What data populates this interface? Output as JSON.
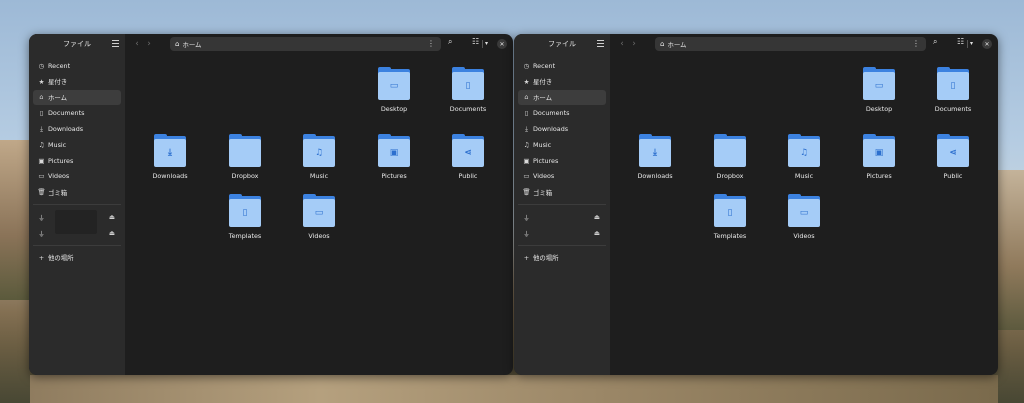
{
  "windows": [
    {
      "sidebar": {
        "title": "ファイル",
        "items": [
          {
            "label": "Recent",
            "icon": "clock-icon"
          },
          {
            "label": "星付き",
            "icon": "star-icon"
          },
          {
            "label": "ホーム",
            "icon": "home-icon",
            "active": true
          },
          {
            "label": "Documents",
            "icon": "document-icon"
          },
          {
            "label": "Downloads",
            "icon": "download-icon"
          },
          {
            "label": "Music",
            "icon": "music-icon"
          },
          {
            "label": "Pictures",
            "icon": "picture-icon"
          },
          {
            "label": "Videos",
            "icon": "video-icon"
          },
          {
            "label": "ゴミ箱",
            "icon": "trash-icon"
          }
        ],
        "other_locations": "他の場所"
      },
      "path": "ホーム"
    },
    {
      "sidebar": {
        "title": "ファイル",
        "items": [
          {
            "label": "Recent",
            "icon": "clock-icon"
          },
          {
            "label": "星付き",
            "icon": "star-icon"
          },
          {
            "label": "ホーム",
            "icon": "home-icon",
            "active": true
          },
          {
            "label": "Documents",
            "icon": "document-icon"
          },
          {
            "label": "Downloads",
            "icon": "download-icon"
          },
          {
            "label": "Music",
            "icon": "music-icon"
          },
          {
            "label": "Pictures",
            "icon": "picture-icon"
          },
          {
            "label": "Videos",
            "icon": "video-icon"
          },
          {
            "label": "ゴミ箱",
            "icon": "trash-icon"
          }
        ],
        "other_locations": "他の場所"
      },
      "path": "ホーム"
    }
  ],
  "folders": [
    {
      "name": "Desktop",
      "emblem": "folder-emblem"
    },
    {
      "name": "Documents",
      "emblem": "document-emblem"
    },
    {
      "name": "Downloads",
      "emblem": "download-emblem"
    },
    {
      "name": "Dropbox",
      "emblem": ""
    },
    {
      "name": "Music",
      "emblem": "music-emblem"
    },
    {
      "name": "Pictures",
      "emblem": "picture-emblem"
    },
    {
      "name": "Public",
      "emblem": "share-emblem"
    },
    {
      "name": "Templates",
      "emblem": "document-emblem"
    },
    {
      "name": "Videos",
      "emblem": "video-emblem"
    }
  ],
  "colors": {
    "folder_light": "#a5ccf7",
    "folder_dark": "#3c82e0",
    "window_bg": "#1e1e1e",
    "sidebar_bg": "#2b2b2b"
  }
}
